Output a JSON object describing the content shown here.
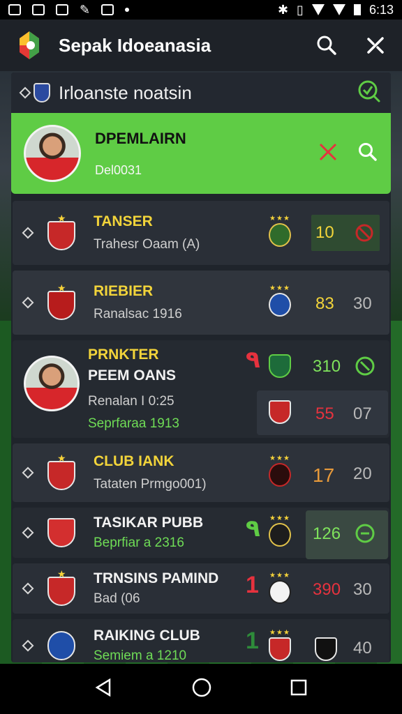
{
  "status_bar": {
    "time": "6:13"
  },
  "app_bar": {
    "title": "Sepak Idoeanasia",
    "search_icon": "search-icon",
    "menu_icon": "shuffle-icon"
  },
  "list_header": {
    "title": "Irloanste noatsin",
    "check_icon": "check-search-icon"
  },
  "featured": {
    "name": "DPEMLAIRN",
    "subtitle": "Del0031"
  },
  "rows": [
    {
      "name": "TANSER",
      "desc": "Trahesr Oaam (A)",
      "value1": "10",
      "value2": ""
    },
    {
      "name": "RIEBIER",
      "desc": "Ranalsac 1916",
      "value1": "83",
      "value2": "30"
    },
    {
      "name": "PRNKTER",
      "name2": "PEEM OANS",
      "desc": "Renalan I 0:25",
      "desc2": "Seprfaraa 1913",
      "value1": "310",
      "value2": "",
      "value3": "55",
      "value4": "07",
      "flag": "٩"
    },
    {
      "name": "CLUB IANK",
      "desc": "Tataten Prmgo001)",
      "value1": "17",
      "value2": "20"
    },
    {
      "name": "TASIKAR PUBB",
      "desc": "Beprfiar a 2316",
      "value1": "126",
      "value2": "",
      "flag": "٩"
    },
    {
      "name": "TRNSINS PAMIND",
      "desc": "Bad (06",
      "value1": "390",
      "value2": "30",
      "flag": "1"
    },
    {
      "name": "RAIKING CLUB",
      "desc": "Semiem a 1210",
      "value1": "",
      "value2": "40",
      "flag": "1"
    }
  ],
  "colors": {
    "accent_green": "#5fcc45",
    "panel": "#1f242b",
    "gold": "#f2d43a",
    "red": "#e6323e"
  }
}
